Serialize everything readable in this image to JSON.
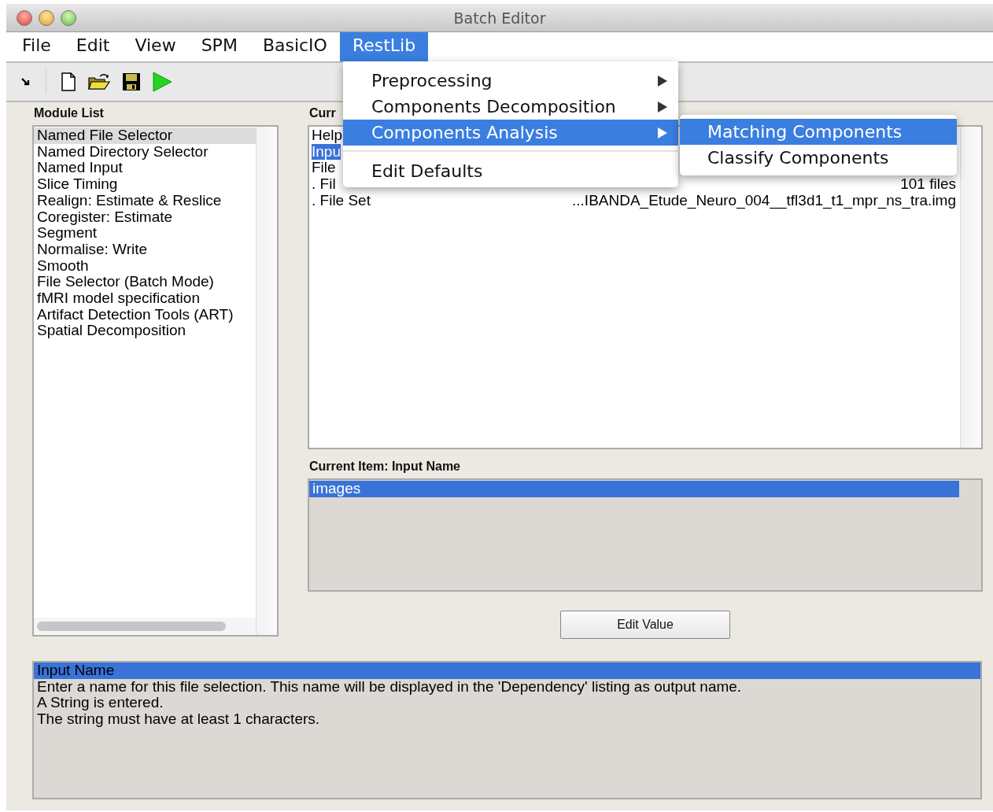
{
  "window": {
    "title": "Batch Editor"
  },
  "menu_bar": [
    {
      "label": "File",
      "selected": false
    },
    {
      "label": "Edit",
      "selected": false
    },
    {
      "label": "View",
      "selected": false
    },
    {
      "label": "SPM",
      "selected": false
    },
    {
      "label": "BasicIO",
      "selected": false
    },
    {
      "label": "RestLib",
      "selected": true
    }
  ],
  "menu": {
    "items": [
      {
        "kind": "item",
        "label": "Preprocessing",
        "has_submenu": true,
        "selected": false
      },
      {
        "kind": "item",
        "label": "Components Decomposition",
        "has_submenu": true,
        "selected": false
      },
      {
        "kind": "item",
        "label": "Components Analysis",
        "has_submenu": true,
        "selected": true
      },
      {
        "kind": "separator"
      },
      {
        "kind": "item",
        "label": "Edit Defaults",
        "has_submenu": false,
        "selected": false
      }
    ]
  },
  "submenu": {
    "items": [
      {
        "label": "Matching Components",
        "selected": true
      },
      {
        "label": "Classify Components",
        "selected": false
      }
    ]
  },
  "module_list": {
    "title": "Module List",
    "items": [
      {
        "label": "Named File Selector",
        "selected": true
      },
      {
        "label": "Named Directory Selector",
        "selected": false
      },
      {
        "label": "Named Input",
        "selected": false
      },
      {
        "label": "Slice Timing",
        "selected": false
      },
      {
        "label": "Realign: Estimate & Reslice",
        "selected": false
      },
      {
        "label": "Coregister: Estimate",
        "selected": false
      },
      {
        "label": "Segment",
        "selected": false
      },
      {
        "label": "Normalise: Write",
        "selected": false
      },
      {
        "label": "Smooth",
        "selected": false
      },
      {
        "label": "File Selector (Batch Mode)",
        "selected": false
      },
      {
        "label": "fMRI model specification",
        "selected": false
      },
      {
        "label": "Artifact Detection Tools (ART)",
        "selected": false
      },
      {
        "label": "Spatial Decomposition",
        "selected": false
      }
    ]
  },
  "current_module": {
    "title": "Curr",
    "rows": [
      {
        "label": "Help",
        "selected": false
      },
      {
        "label": "Inpu",
        "selected": true
      },
      {
        "label": "File",
        "selected": false
      },
      {
        "label": ". Fil",
        "value": "101 files",
        "selected": false
      },
      {
        "label": ". File Set",
        "value": "...IBANDA_Etude_Neuro_004__tfl3d1_t1_mpr_ns_tra.img",
        "selected": false
      }
    ]
  },
  "current_item": {
    "title": "Current Item: Input Name",
    "values": [
      {
        "label": "images",
        "selected": true
      }
    ]
  },
  "edit_value_button": "Edit Value",
  "help": {
    "lines": [
      {
        "text": "Input Name",
        "selected": true
      },
      {
        "text": "Enter a name for this file selection. This name will be displayed in the 'Dependency' listing as output name.",
        "selected": false
      },
      {
        "text": "A String is entered.",
        "selected": false
      },
      {
        "text": "The string must have at least 1 characters.",
        "selected": false
      }
    ]
  }
}
